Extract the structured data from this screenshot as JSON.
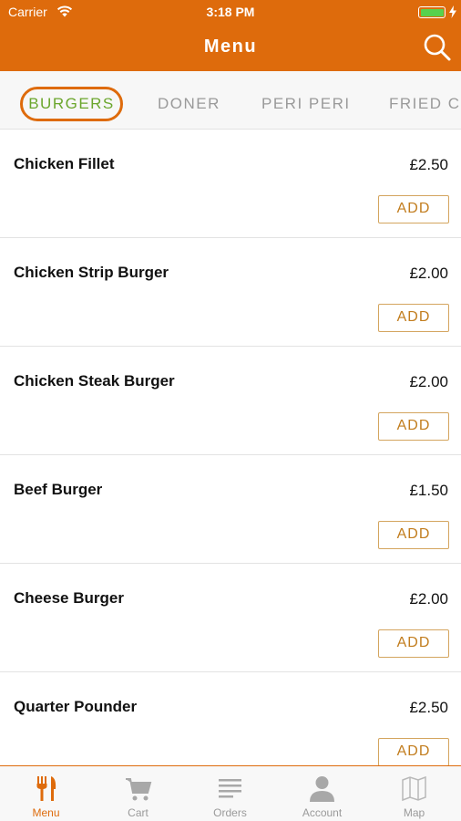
{
  "status_bar": {
    "carrier": "Carrier",
    "time": "3:18 PM"
  },
  "header": {
    "title": "Menu",
    "search_icon": "search-icon"
  },
  "categories": [
    "BURGERS",
    "DONER",
    "PERI PERI",
    "FRIED CH"
  ],
  "selected_category": "BURGERS",
  "items": [
    {
      "name": "Chicken Fillet",
      "price": "£2.50",
      "add_label": "ADD"
    },
    {
      "name": "Chicken Strip Burger",
      "price": "£2.00",
      "add_label": "ADD"
    },
    {
      "name": "Chicken Steak Burger",
      "price": "£2.00",
      "add_label": "ADD"
    },
    {
      "name": "Beef Burger",
      "price": "£1.50",
      "add_label": "ADD"
    },
    {
      "name": "Cheese Burger",
      "price": "£2.00",
      "add_label": "ADD"
    },
    {
      "name": "Quarter Pounder",
      "price": "£2.50",
      "add_label": "ADD"
    }
  ],
  "tab_bar": [
    {
      "label": "Menu",
      "icon": "fork-knife-icon",
      "active": true
    },
    {
      "label": "Cart",
      "icon": "cart-icon",
      "active": false
    },
    {
      "label": "Orders",
      "icon": "orders-list-icon",
      "active": false
    },
    {
      "label": "Account",
      "icon": "account-icon",
      "active": false
    },
    {
      "label": "Map",
      "icon": "map-icon",
      "active": false
    }
  ],
  "colors": {
    "brand": "#de6b0c",
    "active_tab_text": "#6ba62d",
    "add_button": "#c27d1e",
    "battery": "#58d14d"
  }
}
